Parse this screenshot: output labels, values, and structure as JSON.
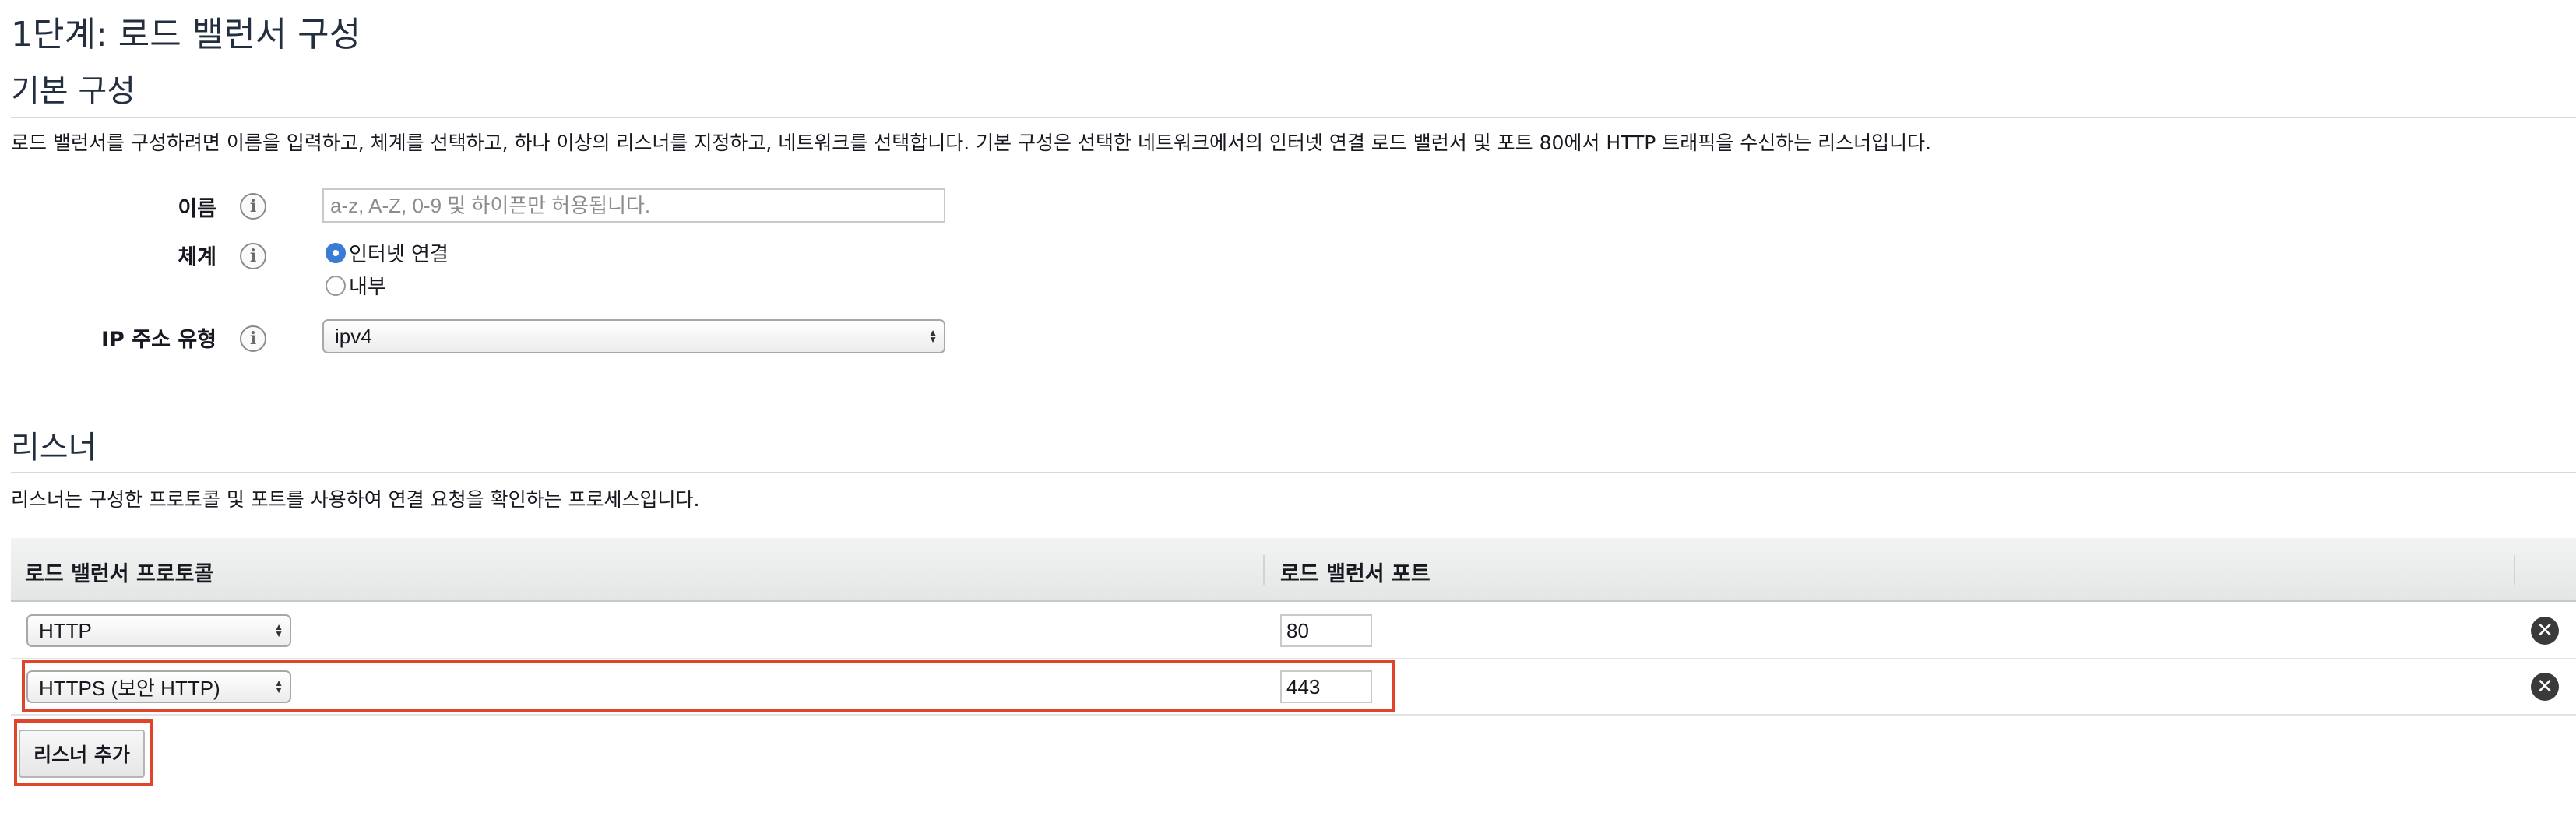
{
  "page": {
    "step_title": "1단계: 로드 밸런서 구성"
  },
  "basic": {
    "title": "기본 구성",
    "description": "로드 밸런서를 구성하려면 이름을 입력하고, 체계를 선택하고, 하나 이상의 리스너를 지정하고, 네트워크를 선택합니다. 기본 구성은 선택한 네트워크에서의 인터넷 연결 로드 밸런서 및 포트 80에서 HTTP 트래픽을 수신하는 리스너입니다.",
    "name_label": "이름",
    "name_placeholder": "a-z, A-Z, 0-9 및 하이픈만 허용됩니다.",
    "name_value": "",
    "scheme_label": "체계",
    "scheme_options": [
      "인터넷 연결",
      "내부"
    ],
    "scheme_selected": "인터넷 연결",
    "ip_label": "IP 주소 유형",
    "ip_value": "ipv4",
    "info_icon_glyph": "i"
  },
  "listeners": {
    "title": "리스너",
    "description": "리스너는 구성한 프로토콜 및 포트를 사용하여 연결 요청을 확인하는 프로세스입니다.",
    "col_protocol": "로드 밸런서 프로토콜",
    "col_port": "로드 밸런서 포트",
    "rows": [
      {
        "protocol": "HTTP",
        "port": "80"
      },
      {
        "protocol": "HTTPS (보안 HTTP)",
        "port": "443"
      }
    ],
    "add_button": "리스너 추가",
    "remove_icon_glyph": "✕"
  },
  "colors": {
    "highlight": "#e0452b",
    "radio_selected": "#3a7bd5"
  }
}
